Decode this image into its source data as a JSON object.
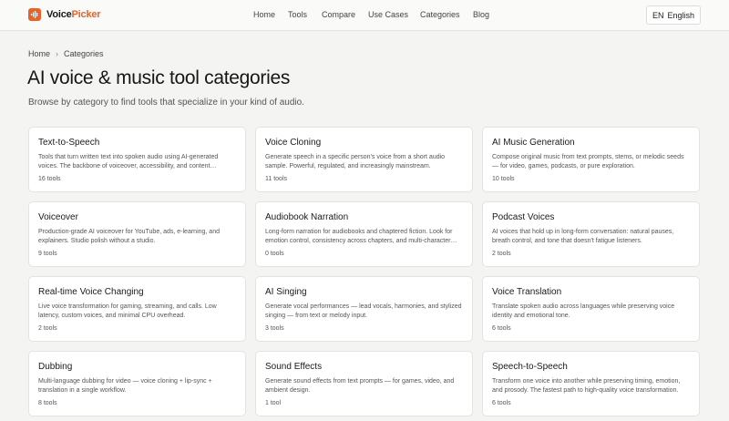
{
  "brand": {
    "name_part1": "Voice",
    "name_part2": "Picker",
    "accent": "#e8622a"
  },
  "nav": [
    "Home",
    "Tools",
    "Compare",
    "Use Cases",
    "Categories",
    "Blog"
  ],
  "lang": {
    "code": "EN",
    "label": "English"
  },
  "breadcrumb": [
    "Home",
    "Categories"
  ],
  "page": {
    "title": "AI voice & music tool categories",
    "subtitle": "Browse by category to find tools that specialize in your kind of audio."
  },
  "categories": [
    {
      "title": "Text-to-Speech",
      "desc": "Tools that turn written text into spoken audio using AI-generated voices. The backbone of voiceover, accessibility, and content…",
      "count": "16 tools"
    },
    {
      "title": "Voice Cloning",
      "desc": "Generate speech in a specific person's voice from a short audio sample. Powerful, regulated, and increasingly mainstream.",
      "count": "11 tools"
    },
    {
      "title": "AI Music Generation",
      "desc": "Compose original music from text prompts, stems, or melodic seeds — for video, games, podcasts, or pure exploration.",
      "count": "10 tools"
    },
    {
      "title": "Voiceover",
      "desc": "Production-grade AI voiceover for YouTube, ads, e-learning, and explainers. Studio polish without a studio.",
      "count": "9 tools"
    },
    {
      "title": "Audiobook Narration",
      "desc": "Long-form narration for audiobooks and chaptered fiction. Look for emotion control, consistency across chapters, and multi-character…",
      "count": "0 tools"
    },
    {
      "title": "Podcast Voices",
      "desc": "AI voices that hold up in long-form conversation: natural pauses, breath control, and tone that doesn't fatigue listeners.",
      "count": "2 tools"
    },
    {
      "title": "Real-time Voice Changing",
      "desc": "Live voice transformation for gaming, streaming, and calls. Low latency, custom voices, and minimal CPU overhead.",
      "count": "2 tools"
    },
    {
      "title": "AI Singing",
      "desc": "Generate vocal performances — lead vocals, harmonies, and stylized singing — from text or melody input.",
      "count": "3 tools"
    },
    {
      "title": "Voice Translation",
      "desc": "Translate spoken audio across languages while preserving voice identity and emotional tone.",
      "count": "6 tools"
    },
    {
      "title": "Dubbing",
      "desc": "Multi-language dubbing for video — voice cloning + lip-sync + translation in a single workflow.",
      "count": "8 tools"
    },
    {
      "title": "Sound Effects",
      "desc": "Generate sound effects from text prompts — for games, video, and ambient design.",
      "count": "1 tool"
    },
    {
      "title": "Speech-to-Speech",
      "desc": "Transform one voice into another while preserving timing, emotion, and prosody. The fastest path to high-quality voice transformation.",
      "count": "6 tools"
    }
  ]
}
